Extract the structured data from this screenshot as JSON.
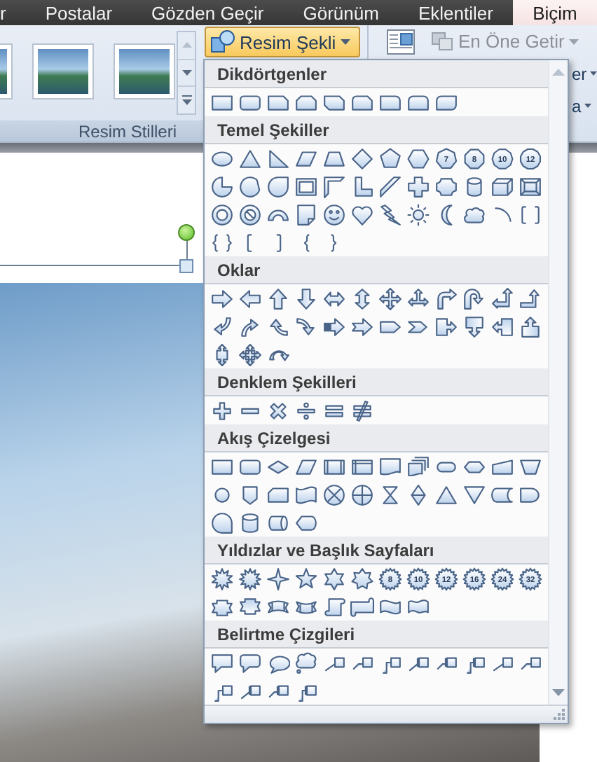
{
  "tabs": [
    {
      "label": "r",
      "selected": false
    },
    {
      "label": "Postalar",
      "selected": false
    },
    {
      "label": "Gözden Geçir",
      "selected": false
    },
    {
      "label": "Görünüm",
      "selected": false
    },
    {
      "label": "Eklentiler",
      "selected": false
    },
    {
      "label": "Biçim",
      "selected": true
    }
  ],
  "picture_styles": {
    "group_label": "Resim Stilleri"
  },
  "picture_shape_button": {
    "label": "Resim Şekli",
    "expanded": true
  },
  "arrange": {
    "bring_to_front": {
      "label": "En Öne Getir",
      "disabled": true
    },
    "row_2": "er",
    "row_3": "a"
  },
  "shape_menu": {
    "sections": [
      {
        "title": "Dikdörtgenler",
        "shapes": [
          {
            "kind": "rectangle"
          },
          {
            "kind": "rounded-rectangle"
          },
          {
            "kind": "snipped-rectangle"
          },
          {
            "kind": "two-snip-rectangle"
          },
          {
            "kind": "diagonal-snip-rectangle"
          },
          {
            "kind": "snip-round-rectangle"
          },
          {
            "kind": "one-round-rectangle"
          },
          {
            "kind": "two-round-rectangle"
          },
          {
            "kind": "diagonal-round-rectangle"
          }
        ]
      },
      {
        "title": "Temel Şekiller",
        "shapes": [
          {
            "kind": "oval"
          },
          {
            "kind": "triangle"
          },
          {
            "kind": "right-triangle"
          },
          {
            "kind": "parallelogram"
          },
          {
            "kind": "trapezoid"
          },
          {
            "kind": "diamond"
          },
          {
            "kind": "pentagon"
          },
          {
            "kind": "hexagon"
          },
          {
            "kind": "heptagon",
            "label": "7"
          },
          {
            "kind": "octagon",
            "label": "8"
          },
          {
            "kind": "decagon",
            "label": "10"
          },
          {
            "kind": "dodecagon",
            "label": "12"
          },
          {
            "kind": "pie"
          },
          {
            "kind": "chord"
          },
          {
            "kind": "teardrop"
          },
          {
            "kind": "frame"
          },
          {
            "kind": "half-frame"
          },
          {
            "kind": "l-shape"
          },
          {
            "kind": "diagonal-stripe"
          },
          {
            "kind": "cross"
          },
          {
            "kind": "plaque"
          },
          {
            "kind": "can"
          },
          {
            "kind": "cube"
          },
          {
            "kind": "bevel"
          },
          {
            "kind": "donut"
          },
          {
            "kind": "no-symbol"
          },
          {
            "kind": "block-arc"
          },
          {
            "kind": "folded-corner"
          },
          {
            "kind": "smiley"
          },
          {
            "kind": "heart"
          },
          {
            "kind": "lightning"
          },
          {
            "kind": "sun"
          },
          {
            "kind": "moon"
          },
          {
            "kind": "cloud"
          },
          {
            "kind": "arc"
          },
          {
            "kind": "double-bracket"
          },
          {
            "kind": "double-brace"
          },
          {
            "kind": "left-bracket"
          },
          {
            "kind": "right-bracket"
          },
          {
            "kind": "left-brace"
          },
          {
            "kind": "right-brace"
          }
        ]
      },
      {
        "title": "Oklar",
        "shapes": [
          {
            "kind": "arrow-right"
          },
          {
            "kind": "arrow-left"
          },
          {
            "kind": "arrow-up"
          },
          {
            "kind": "arrow-down"
          },
          {
            "kind": "left-right-arrow"
          },
          {
            "kind": "up-down-arrow"
          },
          {
            "kind": "quad-arrow"
          },
          {
            "kind": "left-right-up-arrow"
          },
          {
            "kind": "bent-arrow"
          },
          {
            "kind": "u-turn-arrow"
          },
          {
            "kind": "left-up-arrow"
          },
          {
            "kind": "bent-up-arrow"
          },
          {
            "kind": "curved-right-arrow"
          },
          {
            "kind": "curved-left-arrow"
          },
          {
            "kind": "curved-up-arrow"
          },
          {
            "kind": "curved-down-arrow"
          },
          {
            "kind": "striped-arrow"
          },
          {
            "kind": "notched-arrow"
          },
          {
            "kind": "home-plate"
          },
          {
            "kind": "chevron"
          },
          {
            "kind": "right-arrow-callout"
          },
          {
            "kind": "down-arrow-callout"
          },
          {
            "kind": "left-arrow-callout"
          },
          {
            "kind": "up-arrow-callout"
          },
          {
            "kind": "up-down-arrow-callout"
          },
          {
            "kind": "quad-arrow-callout"
          },
          {
            "kind": "circular-arrow"
          }
        ]
      },
      {
        "title": "Denklem Şekilleri",
        "shapes": [
          {
            "kind": "plus"
          },
          {
            "kind": "minus"
          },
          {
            "kind": "multiply"
          },
          {
            "kind": "divide"
          },
          {
            "kind": "equal"
          },
          {
            "kind": "not-equal"
          }
        ]
      },
      {
        "title": "Akış Çizelgesi",
        "shapes": [
          {
            "kind": "process"
          },
          {
            "kind": "alternate-process"
          },
          {
            "kind": "decision"
          },
          {
            "kind": "data"
          },
          {
            "kind": "predefined-process"
          },
          {
            "kind": "internal-storage"
          },
          {
            "kind": "document"
          },
          {
            "kind": "multidocument"
          },
          {
            "kind": "terminator"
          },
          {
            "kind": "preparation"
          },
          {
            "kind": "manual-input"
          },
          {
            "kind": "manual-operation"
          },
          {
            "kind": "connector"
          },
          {
            "kind": "off-page-connector"
          },
          {
            "kind": "card"
          },
          {
            "kind": "punched-tape"
          },
          {
            "kind": "summing-junction"
          },
          {
            "kind": "or-symbol"
          },
          {
            "kind": "collate"
          },
          {
            "kind": "sort"
          },
          {
            "kind": "extract"
          },
          {
            "kind": "merge"
          },
          {
            "kind": "stored-data"
          },
          {
            "kind": "delay"
          },
          {
            "kind": "sequential-access"
          },
          {
            "kind": "magnetic-disk"
          },
          {
            "kind": "direct-access"
          },
          {
            "kind": "display"
          }
        ]
      },
      {
        "title": "Yıldızlar ve Başlık Sayfaları",
        "shapes": [
          {
            "kind": "explosion"
          },
          {
            "kind": "explosion-two"
          },
          {
            "kind": "four-point-star"
          },
          {
            "kind": "five-point-star"
          },
          {
            "kind": "six-point-star"
          },
          {
            "kind": "seven-point-star"
          },
          {
            "kind": "star-badge",
            "label": "8"
          },
          {
            "kind": "star-badge",
            "label": "10"
          },
          {
            "kind": "star-badge",
            "label": "12"
          },
          {
            "kind": "star-badge",
            "label": "16"
          },
          {
            "kind": "star-badge",
            "label": "24"
          },
          {
            "kind": "star-badge",
            "label": "32"
          },
          {
            "kind": "ribbon-down"
          },
          {
            "kind": "ribbon-up"
          },
          {
            "kind": "curved-ribbon-down"
          },
          {
            "kind": "curved-ribbon-up"
          },
          {
            "kind": "vertical-scroll"
          },
          {
            "kind": "horizontal-scroll"
          },
          {
            "kind": "wave"
          },
          {
            "kind": "double-wave"
          }
        ]
      },
      {
        "title": "Belirtme Çizgileri",
        "shapes": [
          {
            "kind": "rectangle-callout"
          },
          {
            "kind": "rounded-callout"
          },
          {
            "kind": "oval-callout"
          },
          {
            "kind": "cloud-callout"
          },
          {
            "kind": "line-callout"
          },
          {
            "kind": "line-callout-two"
          },
          {
            "kind": "line-callout-three"
          },
          {
            "kind": "accent-callout"
          },
          {
            "kind": "accent-callout-two"
          },
          {
            "kind": "accent-callout-three"
          },
          {
            "kind": "border-callout"
          },
          {
            "kind": "border-callout-two"
          },
          {
            "kind": "border-callout-three"
          },
          {
            "kind": "accent-border-callout"
          },
          {
            "kind": "accent-border-callout-two"
          },
          {
            "kind": "accent-border-callout-three"
          }
        ]
      }
    ]
  }
}
